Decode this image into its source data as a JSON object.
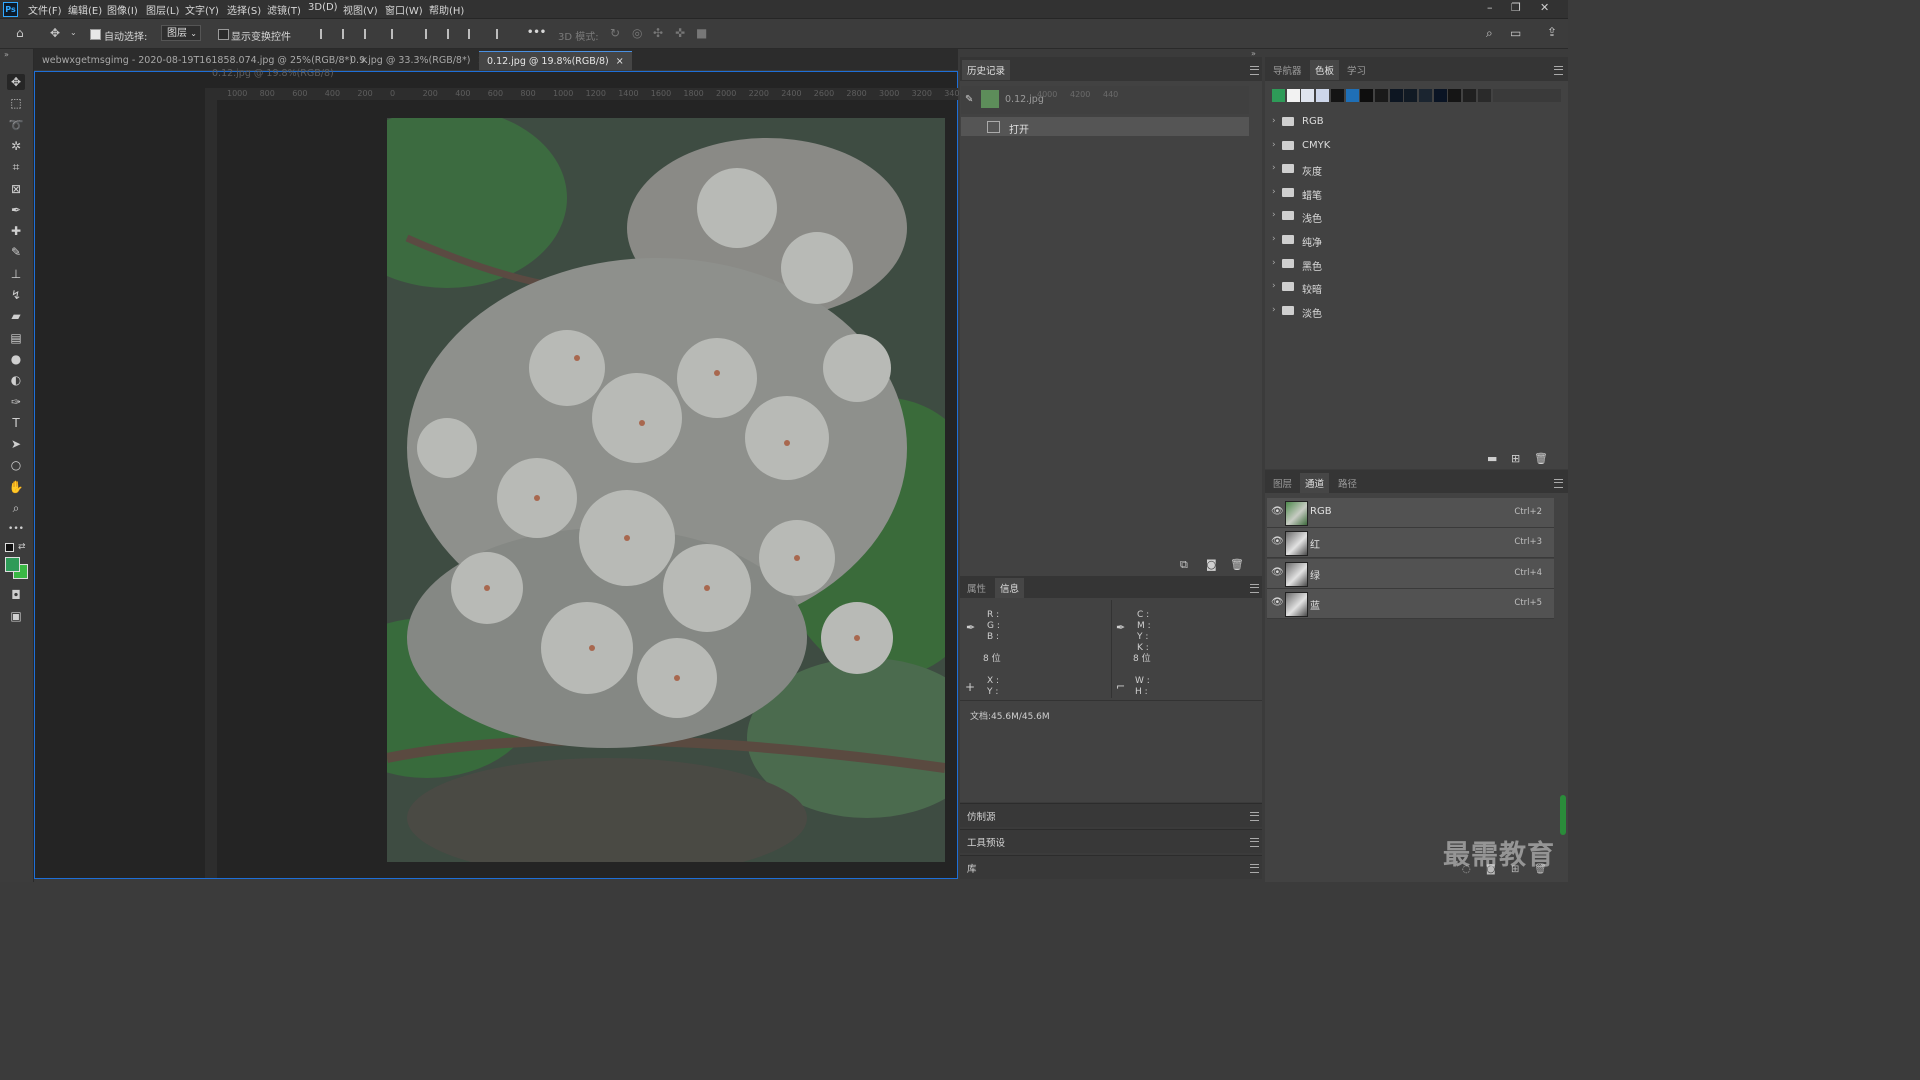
{
  "app": {
    "logo": "Ps"
  },
  "menu": [
    "文件(F)",
    "编辑(E)",
    "图像(I)",
    "图层(L)",
    "文字(Y)",
    "选择(S)",
    "滤镜(T)",
    "3D(D)",
    "视图(V)",
    "窗口(W)",
    "帮助(H)"
  ],
  "window_controls": {
    "minimize": "–",
    "restore": "❐",
    "close": "✕"
  },
  "options": {
    "auto_select_label": "自动选择:",
    "auto_select_checked": true,
    "layer_select_value": "图层",
    "show_transform_label": "显示变换控件",
    "show_transform_checked": false,
    "more": "•••",
    "mode_3d_label": "3D 模式:"
  },
  "tools": [
    "move-tool",
    "marquee-tool",
    "lasso-tool",
    "magic-wand-tool",
    "crop-tool",
    "frame-tool",
    "eyedropper-tool",
    "healing-brush-tool",
    "brush-tool",
    "clone-stamp-tool",
    "history-brush-tool",
    "eraser-tool",
    "gradient-tool",
    "blur-tool",
    "dodge-tool",
    "pen-tool",
    "type-tool",
    "path-selection-tool",
    "ellipse-tool",
    "hand-tool",
    "zoom-tool",
    "more-tools"
  ],
  "colors": {
    "foreground": "#2e9b58",
    "background": "#3ab845",
    "accent": "#1e6fd8"
  },
  "doc_tabs": [
    {
      "title": "webwxgetmsgimg - 2020-08-19T161858.074.jpg @ 25%(RGB/8*)",
      "close": "×",
      "active": false
    },
    {
      "title": "0.9.jpg @ 33.3%(RGB/8*)",
      "close": "×",
      "active": false
    },
    {
      "title": "0.12.jpg @ 19.8%(RGB/8)",
      "close": "×",
      "active": true
    }
  ],
  "ghost_tab": "0.12.jpg @ 19.8%(RGB/8)",
  "ruler_top": [
    "1000",
    "800",
    "600",
    "400",
    "200",
    "0",
    "200",
    "400",
    "600",
    "800",
    "1000",
    "1200",
    "1400",
    "1600",
    "1800",
    "2000",
    "2200",
    "2400",
    "2600",
    "2800",
    "3000",
    "3200",
    "340"
  ],
  "history": {
    "tab": "历史记录",
    "snapshot_name": "0.12.jpg",
    "snapshot_overlay_numbers": [
      "4000",
      "4200",
      "440"
    ],
    "steps": [
      {
        "label": "打开"
      }
    ]
  },
  "info": {
    "tabs": [
      "属性",
      "信息"
    ],
    "active_tab": "信息",
    "rgb_labels": "R :\nG :\nB :",
    "cmyk_labels": "C :\nM :\nY :\nK :",
    "bits_left": "8 位",
    "bits_right": "8 位",
    "xy_labels": "X :\nY :",
    "wh_labels": "W :\nH :",
    "doc_size": "文档:45.6M/45.6M"
  },
  "collapsed_panels": [
    "仿制源",
    "工具预设",
    "库"
  ],
  "swatches_panel": {
    "tabs": [
      "导航器",
      "色板",
      "学习"
    ],
    "active_tab": "色板",
    "colors": [
      "#2e9b58",
      "#f2f2f2",
      "#dfe4ee",
      "#cdd6ea",
      "#141414",
      "#1f6fb6",
      "#0e0e0e",
      "#1a1a1a",
      "#0d1622",
      "#111a24",
      "#1b2530",
      "#0a1424",
      "#151515",
      "#202020",
      "#2a2a2a"
    ],
    "folders": [
      "RGB",
      "CMYK",
      "灰度",
      "蜡笔",
      "浅色",
      "纯净",
      "黑色",
      "较暗",
      "淡色"
    ]
  },
  "layers_panel": {
    "tabs": [
      "图层",
      "通道",
      "路径"
    ],
    "active_tab": "通道",
    "channels": [
      {
        "name": "RGB",
        "shortcut": "Ctrl+2"
      },
      {
        "name": "红",
        "shortcut": "Ctrl+3"
      },
      {
        "name": "绿",
        "shortcut": "Ctrl+4"
      },
      {
        "name": "蓝",
        "shortcut": "Ctrl+5"
      }
    ]
  },
  "watermark": "最需教育"
}
